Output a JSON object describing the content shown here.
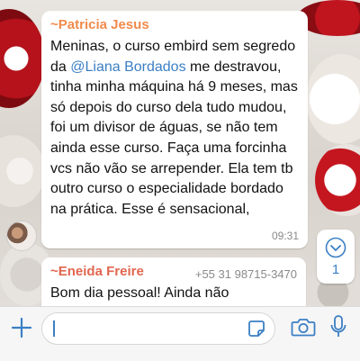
{
  "messages": [
    {
      "sender": "~Patricia Jesus",
      "sender_color": "#f08a4b",
      "text_before": "Meninas, o curso embird sem segredo da ",
      "mention": "@Liana Bordados",
      "text_after": " me destravou, tinha minha máquina há 9 meses,  mas só depois do curso dela tudo mudou, foi um divisor de águas, se não tem ainda esse curso. Faça uma forcinha vcs não vão se arrepender. Ela tem tb outro curso o especialidade bordado na prática.  Esse é sensacional,",
      "time": "09:31"
    },
    {
      "sender": "~Eneida Freire",
      "sender_color": "#e0664f",
      "phone": "+55 31 98715-3470",
      "text": "Bom dia pessoal! Ainda não"
    }
  ],
  "scroll_button": {
    "icon": "chevron-down-icon",
    "unread_count": "1"
  },
  "composer": {
    "attach_icon": "plus-icon",
    "sticker_icon": "sticker-icon",
    "camera_icon": "camera-icon",
    "mic_icon": "microphone-icon"
  },
  "colors": {
    "accent": "#3b7fc4"
  }
}
